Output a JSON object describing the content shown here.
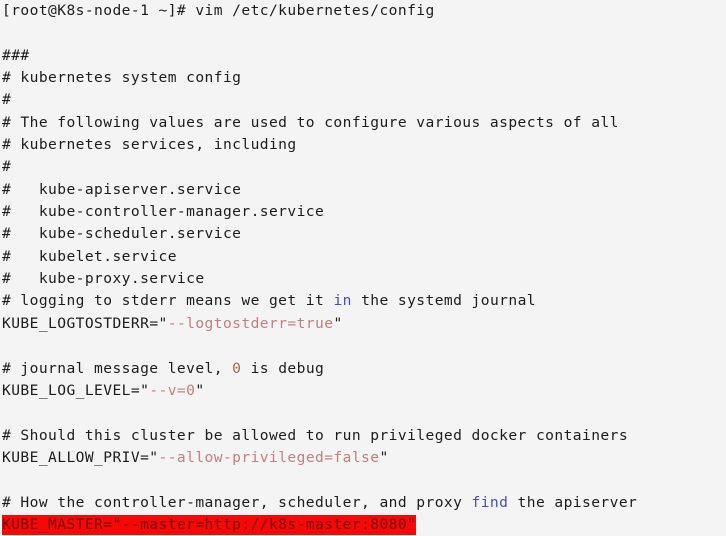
{
  "terminal": {
    "background_color": "#f4f4f4",
    "foreground_color": "#1c1c1c",
    "prompt_line": "[root@K8s-node-1 ~]# vim /etc/kubernetes/config",
    "prompt": {
      "user_host": "[root@K8s-node-1 ~]#",
      "command": "vim /etc/kubernetes/config",
      "host_digit": "1"
    }
  },
  "colors": {
    "keyword": "#4a4ac8",
    "string": "#bf8080",
    "number": "#9b6b4a",
    "highlight_background": "#f40808",
    "highlight_foreground": "#7a0505"
  },
  "editor": {
    "file_path": "/etc/kubernetes/config",
    "lines": [
      {
        "n": 1,
        "text": "###",
        "type": "comment"
      },
      {
        "n": 2,
        "text": "# kubernetes system config",
        "type": "comment"
      },
      {
        "n": 3,
        "text": "#",
        "type": "comment"
      },
      {
        "n": 4,
        "text": "# The following values are used to configure various aspects of all",
        "type": "comment"
      },
      {
        "n": 5,
        "text": "# kubernetes services, including",
        "type": "comment"
      },
      {
        "n": 6,
        "text": "#",
        "type": "comment"
      },
      {
        "n": 7,
        "text": "#   kube-apiserver.service",
        "type": "comment"
      },
      {
        "n": 8,
        "text": "#   kube-controller-manager.service",
        "type": "comment"
      },
      {
        "n": 9,
        "text": "#   kube-scheduler.service",
        "type": "comment"
      },
      {
        "n": 10,
        "text": "#   kubelet.service",
        "type": "comment"
      },
      {
        "n": 11,
        "text": "#   kube-proxy.service",
        "type": "comment"
      },
      {
        "n": 12,
        "text": "# logging to stderr means we get it in the systemd journal",
        "type": "comment"
      },
      {
        "n": 13,
        "text": "KUBE_LOGTOSTDERR=\"--logtostderr=true\"",
        "type": "assignment"
      },
      {
        "n": 14,
        "text": "",
        "type": "blank"
      },
      {
        "n": 15,
        "text": "# journal message level, 0 is debug",
        "type": "comment"
      },
      {
        "n": 16,
        "text": "KUBE_LOG_LEVEL=\"--v=0\"",
        "type": "assignment"
      },
      {
        "n": 17,
        "text": "",
        "type": "blank"
      },
      {
        "n": 18,
        "text": "# Should this cluster be allowed to run privileged docker containers",
        "type": "comment"
      },
      {
        "n": 19,
        "text": "KUBE_ALLOW_PRIV=\"--allow-privileged=false\"",
        "type": "assignment"
      },
      {
        "n": 20,
        "text": "",
        "type": "blank"
      },
      {
        "n": 21,
        "text": "# How the controller-manager, scheduler, and proxy find the apiserver",
        "type": "comment"
      },
      {
        "n": 22,
        "text": "KUBE_MASTER=\"--master=http://k8s-master:8080\"",
        "type": "assignment",
        "highlighted": true
      }
    ],
    "tokens": {
      "line12_keyword": "in",
      "line15_number": "0",
      "line21_keyword": "find",
      "line13_var": "KUBE_LOGTOSTDERR",
      "line13_value": "--logtostderr=true",
      "line16_var": "KUBE_LOG_LEVEL",
      "line16_value": "--v=0",
      "line19_var": "KUBE_ALLOW_PRIV",
      "line19_value": "--allow-privileged=false",
      "line22_var": "KUBE_MASTER",
      "line22_value": "--master=http://k8s-master:8080"
    },
    "segments": {
      "line12_a": "# logging to stderr means we get it ",
      "line12_b": " the systemd journal",
      "line15_a": "# journal message level, ",
      "line15_b": " is debug",
      "line21_a": "# How the controller-manager, scheduler, and proxy ",
      "line21_b": " the apiserver",
      "eq_quote": "=\"",
      "end_quote": "\""
    }
  }
}
